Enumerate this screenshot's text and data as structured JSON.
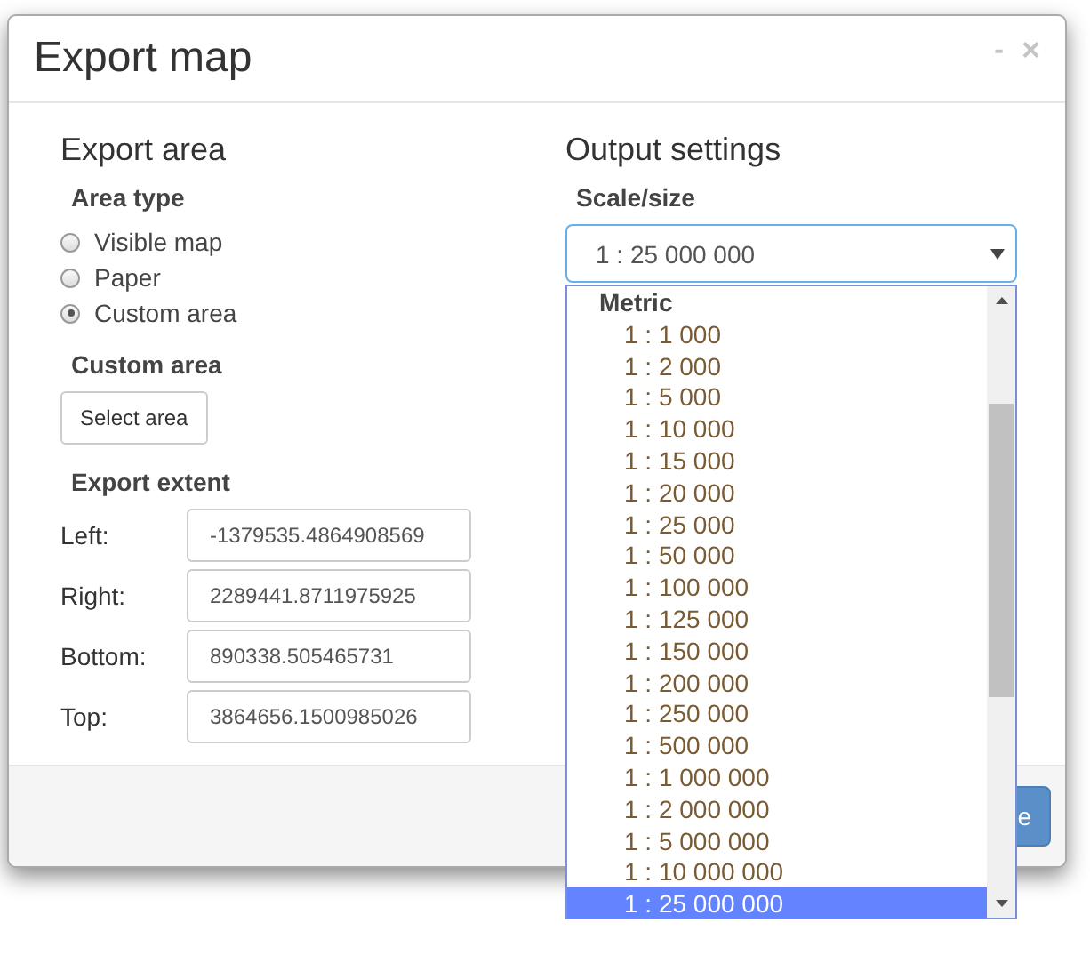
{
  "dialog": {
    "title": "Export map",
    "minimize": "-",
    "close": "×"
  },
  "export_area": {
    "heading": "Export area",
    "area_type_label": "Area type",
    "area_types": [
      {
        "label": "Visible map",
        "selected": false
      },
      {
        "label": "Paper",
        "selected": false
      },
      {
        "label": "Custom area",
        "selected": true
      }
    ],
    "custom_area_label": "Custom area",
    "select_area_button": "Select area",
    "extent_label": "Export extent",
    "extent": [
      {
        "label": "Left:",
        "value": "-1379535.4864908569"
      },
      {
        "label": "Right:",
        "value": "2289441.8711975925"
      },
      {
        "label": "Bottom:",
        "value": "890338.505465731"
      },
      {
        "label": "Top:",
        "value": "3864656.1500985026"
      }
    ]
  },
  "output_settings": {
    "heading": "Output settings",
    "scale_label": "Scale/size",
    "scale_value": "1 : 25 000 000",
    "expanded": true,
    "options": [
      {
        "kind": "group",
        "label": "Metric",
        "selected": false
      },
      {
        "kind": "option",
        "label": "1 : 1 000",
        "selected": false
      },
      {
        "kind": "option",
        "label": "1 : 2 000",
        "selected": false
      },
      {
        "kind": "option",
        "label": "1 : 5 000",
        "selected": false
      },
      {
        "kind": "option",
        "label": "1 : 10 000",
        "selected": false
      },
      {
        "kind": "option",
        "label": "1 : 15 000",
        "selected": false
      },
      {
        "kind": "option",
        "label": "1 : 20 000",
        "selected": false
      },
      {
        "kind": "option",
        "label": "1 : 25 000",
        "selected": false
      },
      {
        "kind": "option",
        "label": "1 : 50 000",
        "selected": false
      },
      {
        "kind": "option",
        "label": "1 : 100 000",
        "selected": false
      },
      {
        "kind": "option",
        "label": "1 : 125 000",
        "selected": false
      },
      {
        "kind": "option",
        "label": "1 : 150 000",
        "selected": false
      },
      {
        "kind": "option",
        "label": "1 : 200 000",
        "selected": false
      },
      {
        "kind": "option",
        "label": "1 : 250 000",
        "selected": false
      },
      {
        "kind": "option",
        "label": "1 : 500 000",
        "selected": false
      },
      {
        "kind": "option",
        "label": "1 : 1 000 000",
        "selected": false
      },
      {
        "kind": "option",
        "label": "1 : 2 000 000",
        "selected": false
      },
      {
        "kind": "option",
        "label": "1 : 5 000 000",
        "selected": false
      },
      {
        "kind": "option",
        "label": "1 : 10 000 000",
        "selected": false
      },
      {
        "kind": "option",
        "label": "1 : 25 000 000",
        "selected": true
      }
    ]
  },
  "footer": {
    "button": "e"
  }
}
